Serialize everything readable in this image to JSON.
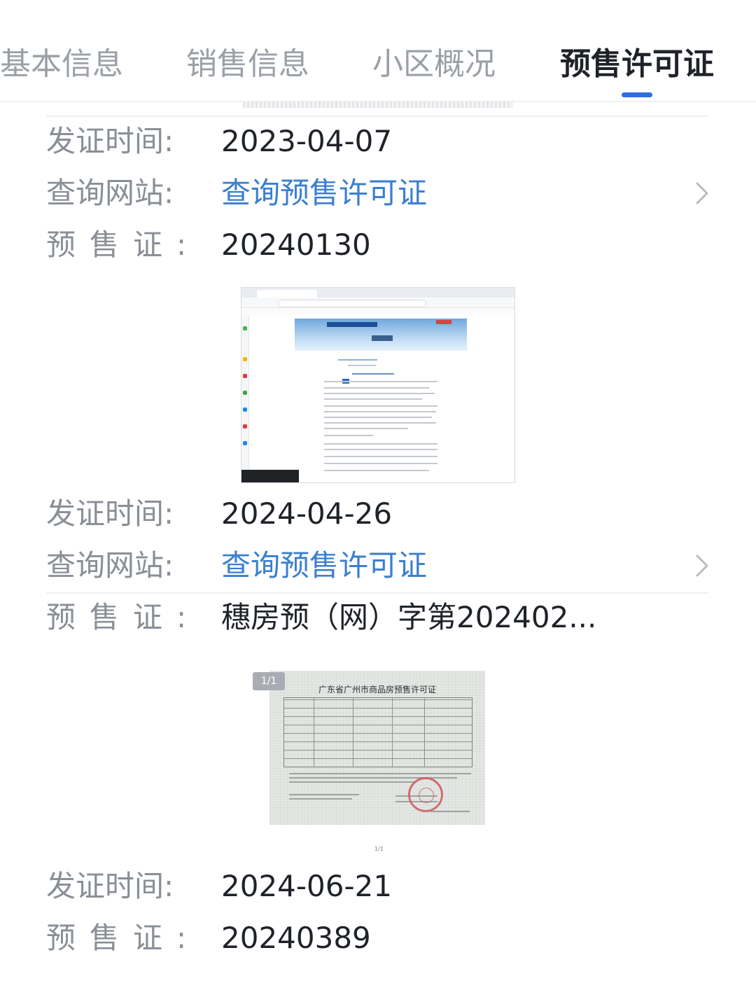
{
  "tabs": [
    {
      "label": "基本信息",
      "active": false
    },
    {
      "label": "销售信息",
      "active": false
    },
    {
      "label": "小区概况",
      "active": false
    },
    {
      "label": "预售许可证",
      "active": true
    }
  ],
  "accent_color": "#2f6fe0",
  "link_color": "#3b7fd1",
  "labels": {
    "issue_date": "发证时间:",
    "query_site": "查询网站:",
    "permit": "预售证:"
  },
  "permits": [
    {
      "issue_date": "2023-04-07",
      "query_link": "查询预售许可证",
      "permit_no": "20240130"
    },
    {
      "issue_date": "2024-04-26",
      "query_link": "查询预售许可证",
      "permit_no": "穗房预（网）字第202402..."
    },
    {
      "issue_date": "2024-06-21",
      "permit_no": "20240389"
    }
  ],
  "certificate": {
    "page_badge": "1/1",
    "title": "广东省广州市商品房预售许可证",
    "page_mark": "1/1"
  },
  "icons": {
    "row_chevron": "chevron-right-icon"
  }
}
